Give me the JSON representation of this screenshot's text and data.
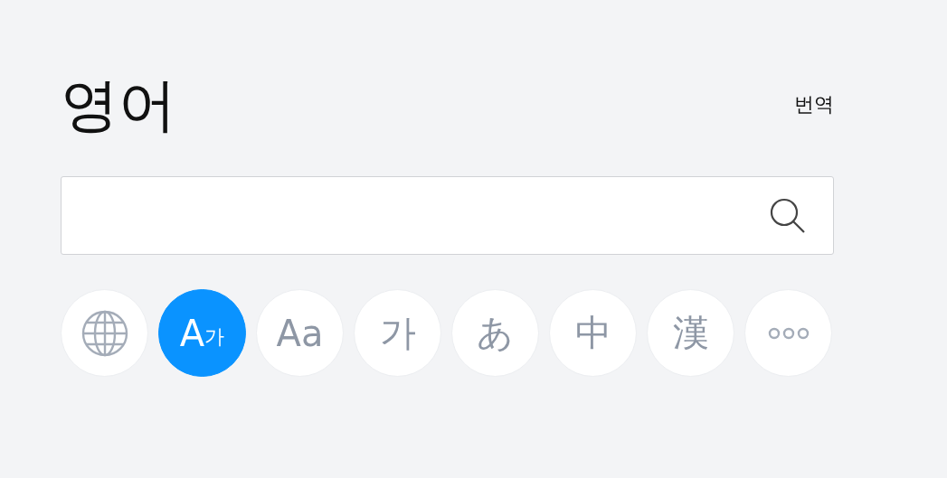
{
  "title": "영어",
  "translate_link": "번역",
  "buttons": [
    {
      "kind": "globe",
      "selected": false
    },
    {
      "kind": "mixed",
      "label": "A",
      "sub": "가",
      "selected": true
    },
    {
      "kind": "text",
      "label": "Aa",
      "selected": false
    },
    {
      "kind": "text",
      "label": "가",
      "selected": false
    },
    {
      "kind": "text",
      "label": "あ",
      "selected": false
    },
    {
      "kind": "text",
      "label": "中",
      "selected": false
    },
    {
      "kind": "text",
      "label": "漢",
      "selected": false
    },
    {
      "kind": "more",
      "selected": false
    }
  ]
}
